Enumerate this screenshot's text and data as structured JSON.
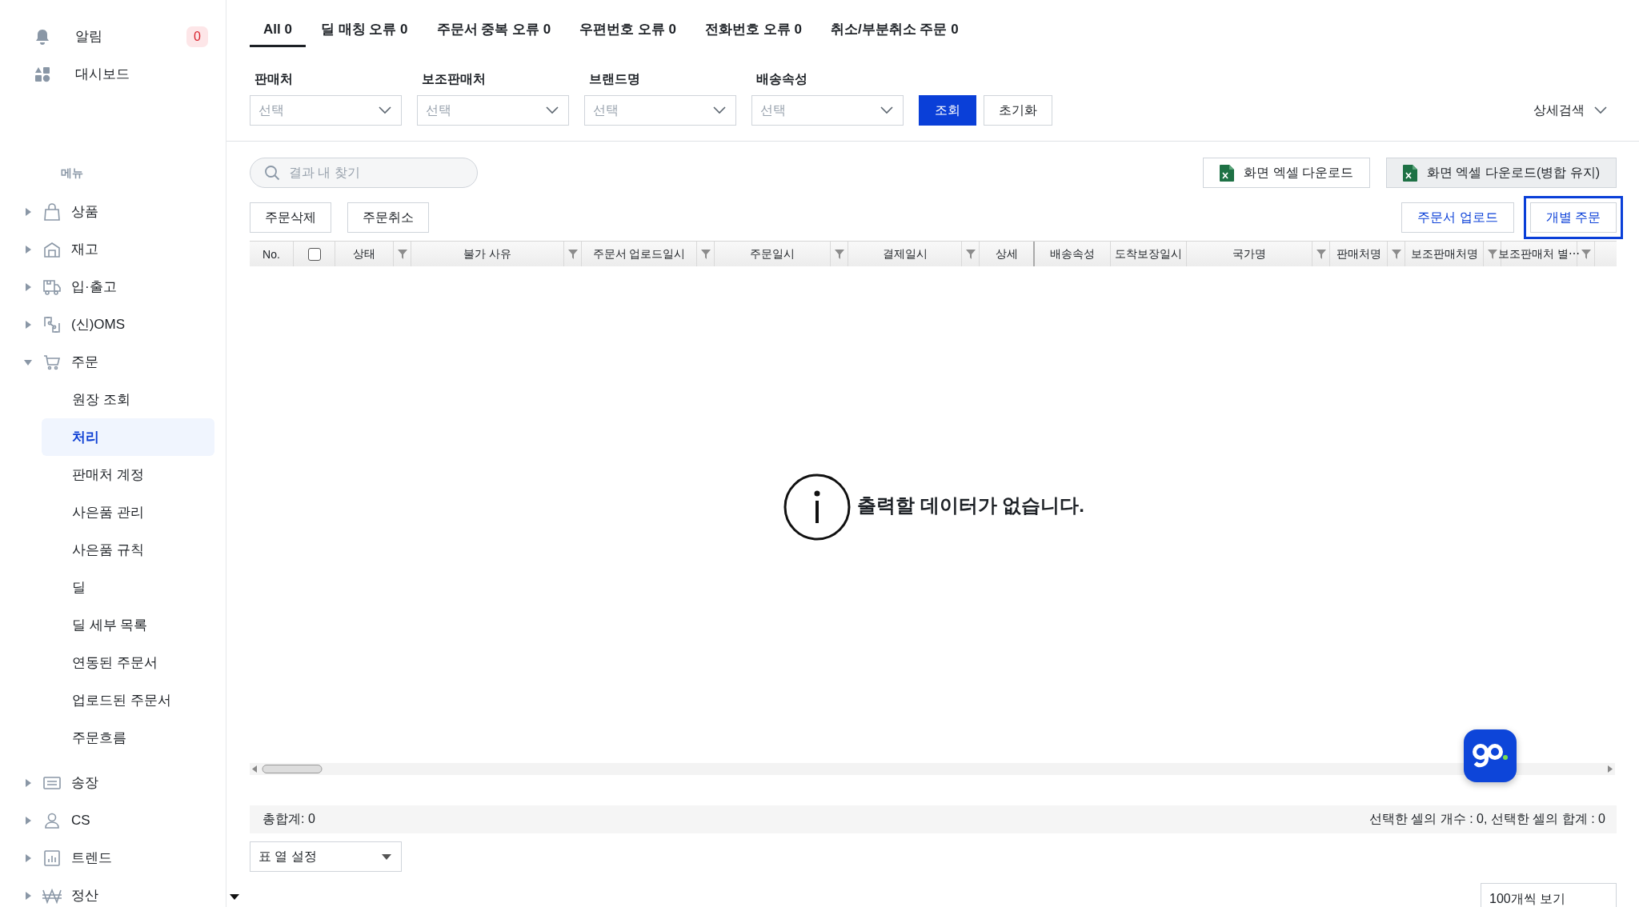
{
  "sidebar": {
    "top_items": [
      {
        "label": "알림",
        "badge": "0"
      },
      {
        "label": "대시보드"
      }
    ],
    "section_label": "메뉴",
    "menu": [
      {
        "label": "상품",
        "expanded": false
      },
      {
        "label": "재고",
        "expanded": false
      },
      {
        "label": "입·출고",
        "expanded": false
      },
      {
        "label": "(신)OMS",
        "expanded": false
      },
      {
        "label": "주문",
        "expanded": true,
        "children": [
          {
            "label": "원장 조회",
            "selected": false
          },
          {
            "label": "처리",
            "selected": true
          },
          {
            "label": "판매처 계정",
            "selected": false
          },
          {
            "label": "사은품 관리",
            "selected": false
          },
          {
            "label": "사은품 규칙",
            "selected": false
          },
          {
            "label": "딜",
            "selected": false
          },
          {
            "label": "딜 세부 목록",
            "selected": false
          },
          {
            "label": "연동된 주문서",
            "selected": false
          },
          {
            "label": "업로드된 주문서",
            "selected": false
          },
          {
            "label": "주문흐름",
            "selected": false
          }
        ]
      },
      {
        "label": "송장",
        "expanded": false
      },
      {
        "label": "CS",
        "expanded": false
      },
      {
        "label": "트렌드",
        "expanded": false
      },
      {
        "label": "정산",
        "expanded": false
      }
    ]
  },
  "tabs": [
    {
      "label": "All 0",
      "selected": true
    },
    {
      "label": "딜 매칭 오류 0",
      "selected": false
    },
    {
      "label": "주문서 중복 오류 0",
      "selected": false
    },
    {
      "label": "우편번호 오류 0",
      "selected": false
    },
    {
      "label": "전화번호 오류 0",
      "selected": false
    },
    {
      "label": "취소/부분취소 주문 0",
      "selected": false
    }
  ],
  "filters": [
    {
      "label": "판매처",
      "placeholder": "선택"
    },
    {
      "label": "보조판매처",
      "placeholder": "선택"
    },
    {
      "label": "브랜드명",
      "placeholder": "선택"
    },
    {
      "label": "배송속성",
      "placeholder": "선택"
    }
  ],
  "search_button": "조회",
  "reset_button": "초기화",
  "advanced_search": "상세검색",
  "search": {
    "placeholder": "결과 내 찾기"
  },
  "export_buttons": [
    {
      "label": "화면 엑셀 다운로드",
      "highlighted": false
    },
    {
      "label": "화면 엑셀 다운로드(병합 유지)",
      "highlighted": true
    }
  ],
  "left_actions": [
    "주문삭제",
    "주문취소"
  ],
  "right_actions": [
    {
      "label": "주문서 업로드",
      "focused": false
    },
    {
      "label": "개별 주문",
      "focused": true
    }
  ],
  "table": {
    "columns": [
      {
        "kind": "text",
        "label": "No.",
        "filter": false
      },
      {
        "kind": "checkbox",
        "checked": false,
        "filter": false
      },
      {
        "kind": "text",
        "label": "상태",
        "filter": true
      },
      {
        "kind": "text",
        "label": "불가 사유",
        "filter": true
      },
      {
        "kind": "text",
        "label": "주문서 업로드일시",
        "filter": true
      },
      {
        "kind": "text",
        "label": "주문일시",
        "filter": true
      },
      {
        "kind": "text",
        "label": "결제일시",
        "filter": true
      },
      {
        "kind": "text",
        "label": "상세",
        "filter": false
      },
      {
        "kind": "text",
        "label": "배송속성",
        "filter": false
      },
      {
        "kind": "text",
        "label": "도착보장일시",
        "filter": false
      },
      {
        "kind": "text",
        "label": "국가명",
        "filter": true
      },
      {
        "kind": "text",
        "label": "판매처명",
        "filter": true
      },
      {
        "kind": "text",
        "label": "보조판매처명",
        "filter": true
      },
      {
        "kind": "text",
        "label": "보조판매처 별⋯",
        "filter": true
      }
    ],
    "empty_message": "출력할 데이터가 없습니다."
  },
  "totals": {
    "left": "총합계: 0",
    "right": "선택한 셀의 개수 : 0, 선택한 셀의 합계 : 0"
  },
  "column_settings": "표 열 설정",
  "page_size": "100개씩 보기"
}
